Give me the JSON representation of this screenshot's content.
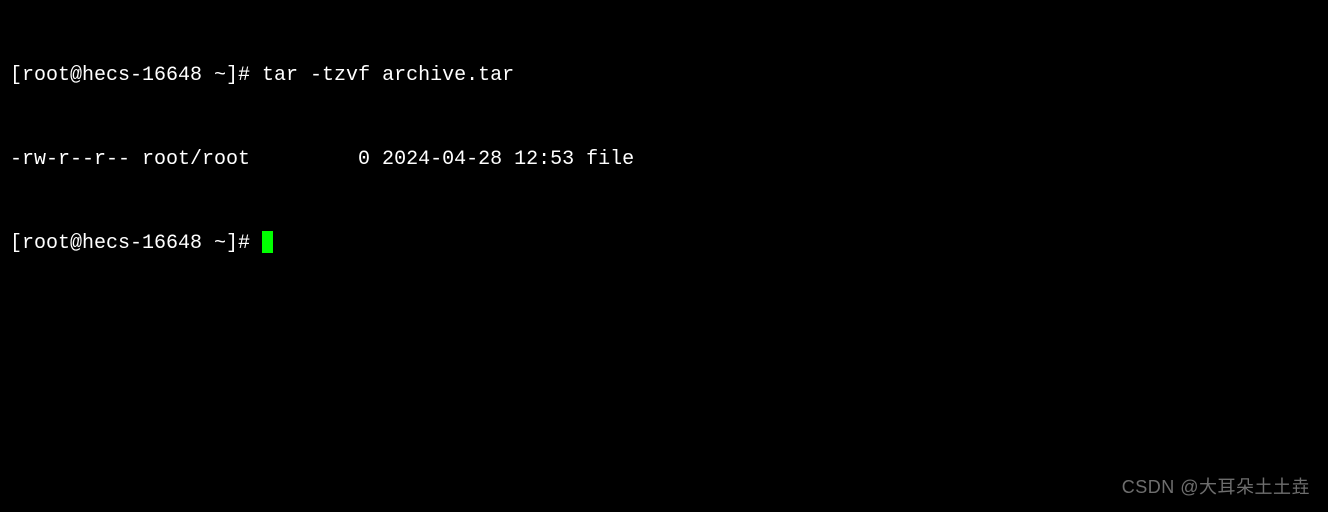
{
  "terminal": {
    "lines": [
      {
        "prompt": "[root@hecs-16648 ~]# ",
        "command": "tar -tzvf archive.tar"
      },
      {
        "output": "-rw-r--r-- root/root         0 2024-04-28 12:53 file"
      },
      {
        "prompt": "[root@hecs-16648 ~]# ",
        "command": ""
      }
    ]
  },
  "watermark": "CSDN @大耳朵土土垚"
}
